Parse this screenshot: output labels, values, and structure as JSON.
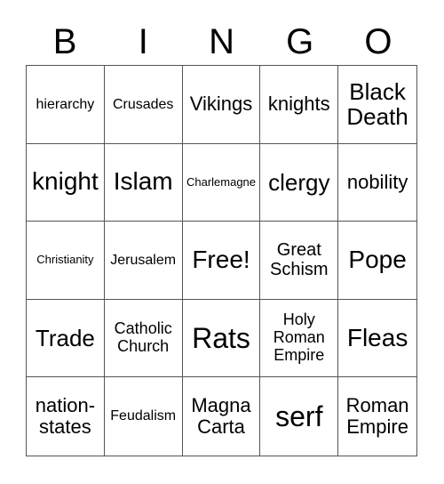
{
  "header": [
    "B",
    "I",
    "N",
    "G",
    "O"
  ],
  "cells": [
    "hierarchy",
    "Crusades",
    "Vikings",
    "knights",
    "Black Death",
    "knight",
    "Islam",
    "Charlemagne",
    "clergy",
    "nobility",
    "Christianity",
    "Jerusalem",
    "Free!",
    "Great Schism",
    "Pope",
    "Trade",
    "Catholic Church",
    "Rats",
    "Holy Roman Empire",
    "Fleas",
    "nation-states",
    "Feudalism",
    "Magna Carta",
    "serf",
    "Roman Empire"
  ]
}
